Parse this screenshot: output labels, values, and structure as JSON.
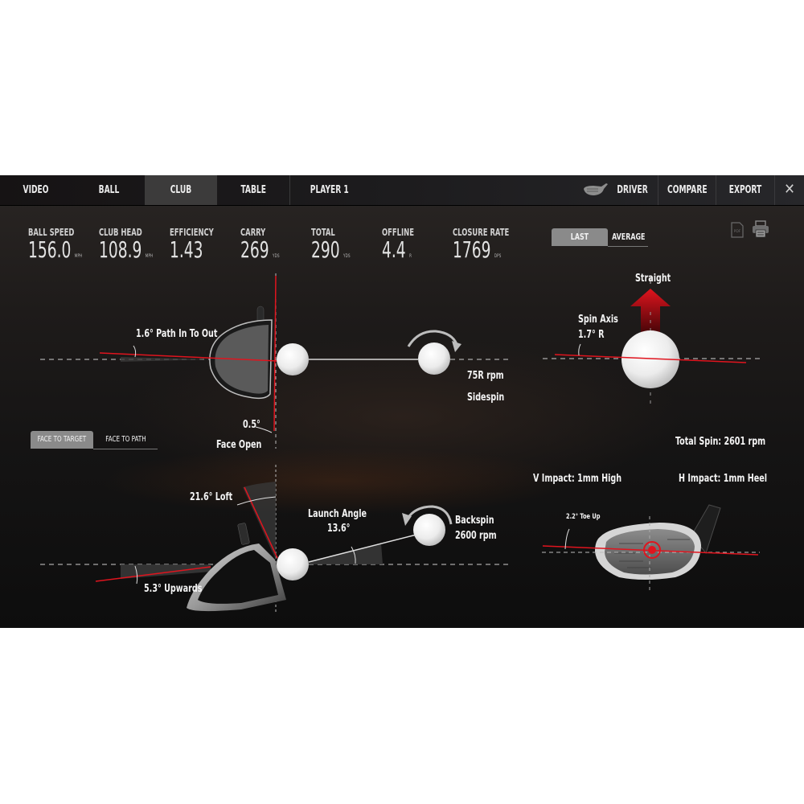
{
  "nav": {
    "tabs": [
      {
        "label": "VIDEO",
        "active": false
      },
      {
        "label": "BALL",
        "active": false
      },
      {
        "label": "CLUB",
        "active": true
      },
      {
        "label": "TABLE",
        "active": false
      },
      {
        "label": "PLAYER 1",
        "active": false
      }
    ],
    "club_label": "DRIVER",
    "compare_label": "COMPARE",
    "export_label": "EXPORT",
    "close_glyph": "✕"
  },
  "metrics": [
    {
      "label": "BALL SPEED",
      "value": "156.0",
      "unit": "MPH"
    },
    {
      "label": "CLUB HEAD",
      "value": "108.9",
      "unit": "MPH"
    },
    {
      "label": "EFFICIENCY",
      "value": "1.43",
      "unit": ""
    },
    {
      "label": "CARRY",
      "value": "269",
      "unit": "YDS"
    },
    {
      "label": "TOTAL",
      "value": "290",
      "unit": "YDS"
    },
    {
      "label": "OFFLINE",
      "value": "4.4",
      "unit": "R"
    },
    {
      "label": "CLOSURE RATE",
      "value": "1769",
      "unit": "DPS"
    }
  ],
  "view_toggle": {
    "options": [
      "LAST",
      "AVERAGE"
    ],
    "selected": "LAST"
  },
  "face_toggle": {
    "options": [
      "FACE TO TARGET",
      "FACE TO PATH"
    ],
    "selected": "FACE TO TARGET"
  },
  "icons": {
    "pdf": "pdf-icon",
    "print": "printer-icon",
    "club": "driver-club-icon"
  },
  "top_view": {
    "path_label": "1.6° Path In To Out",
    "face_angle": "0.5°",
    "face_label": "Face Open",
    "sidespin_value": "75R rpm",
    "sidespin_label": "Sidespin"
  },
  "spin_view": {
    "direction_label": "Straight",
    "spin_axis_label": "Spin Axis",
    "spin_axis_value": "1.7° R",
    "total_spin": "Total Spin: 2601 rpm"
  },
  "side_view": {
    "loft_label": "21.6° Loft",
    "attack_label": "5.3° Upwards",
    "launch_label": "Launch Angle",
    "launch_value": "13.6°",
    "backspin_label": "Backspin",
    "backspin_value": "2600 rpm"
  },
  "impact_view": {
    "v_impact": "V Impact: 1mm High",
    "h_impact": "H Impact: 1mm Heel",
    "lie_label": "2.2° Toe Up"
  },
  "colors": {
    "accent_red": "#e0141e",
    "panel_bg": "#151414",
    "active_tab": "#3c3b3b",
    "toggle_on": "#8a8a8a"
  }
}
